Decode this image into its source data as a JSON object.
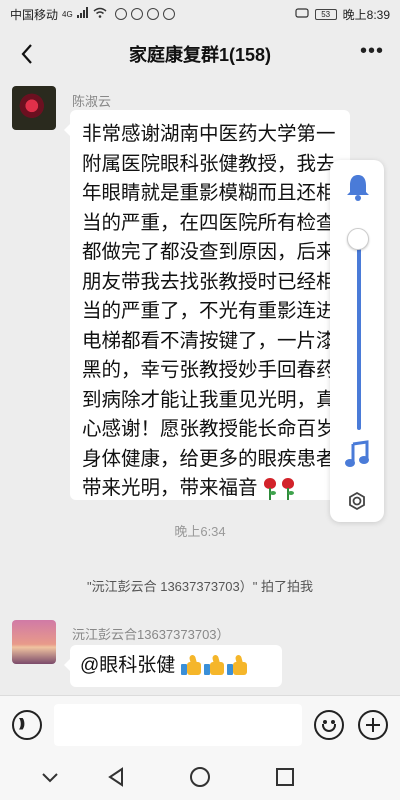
{
  "status_bar": {
    "carrier": "中国移动",
    "network": "4G",
    "battery": "53",
    "time": "晚上8:39"
  },
  "header": {
    "title": "家庭康复群1(158)",
    "back_icon": "chevron-left-icon",
    "more_icon": "ellipsis-icon"
  },
  "messages": [
    {
      "sender": "陈淑云",
      "text": "非常感谢湖南中医药大学第一附属医院眼科张健教授，我去年眼睛就是重影模糊而且还相当的严重，在四医院所有检查都做完了都没查到原因，后来朋友带我去找张教授时已经相当的严重了，不光有重影连进电梯都看不清按键了，一片漆黑的，幸亏张教授妙手回春药到病除才能让我重见光明，真心感谢！愿张教授能长命百岁身体健康，给更多的眼疾患者带来光明，带来福音",
      "emoji": "rose-icon"
    },
    {
      "sender": "沅江彭云合13637373703）",
      "text": "@眼科张健",
      "emoji": "thumbs-up-icon"
    }
  ],
  "timestamp": "晚上6:34",
  "pat_notice": "\"沅江彭云合 13637373703）\" 拍了拍我",
  "floating_panel": {
    "icons": [
      "bell-icon",
      "slider",
      "music-note-icon",
      "gear-icon"
    ],
    "accent": "#4a7bd8"
  },
  "input_bar": {
    "placeholder": "",
    "icons": [
      "voice-icon",
      "emoji-icon",
      "plus-icon"
    ]
  },
  "system_nav": {
    "icons": [
      "chevron-down-icon",
      "back-triangle-icon",
      "home-circle-icon",
      "recent-square-icon"
    ]
  }
}
